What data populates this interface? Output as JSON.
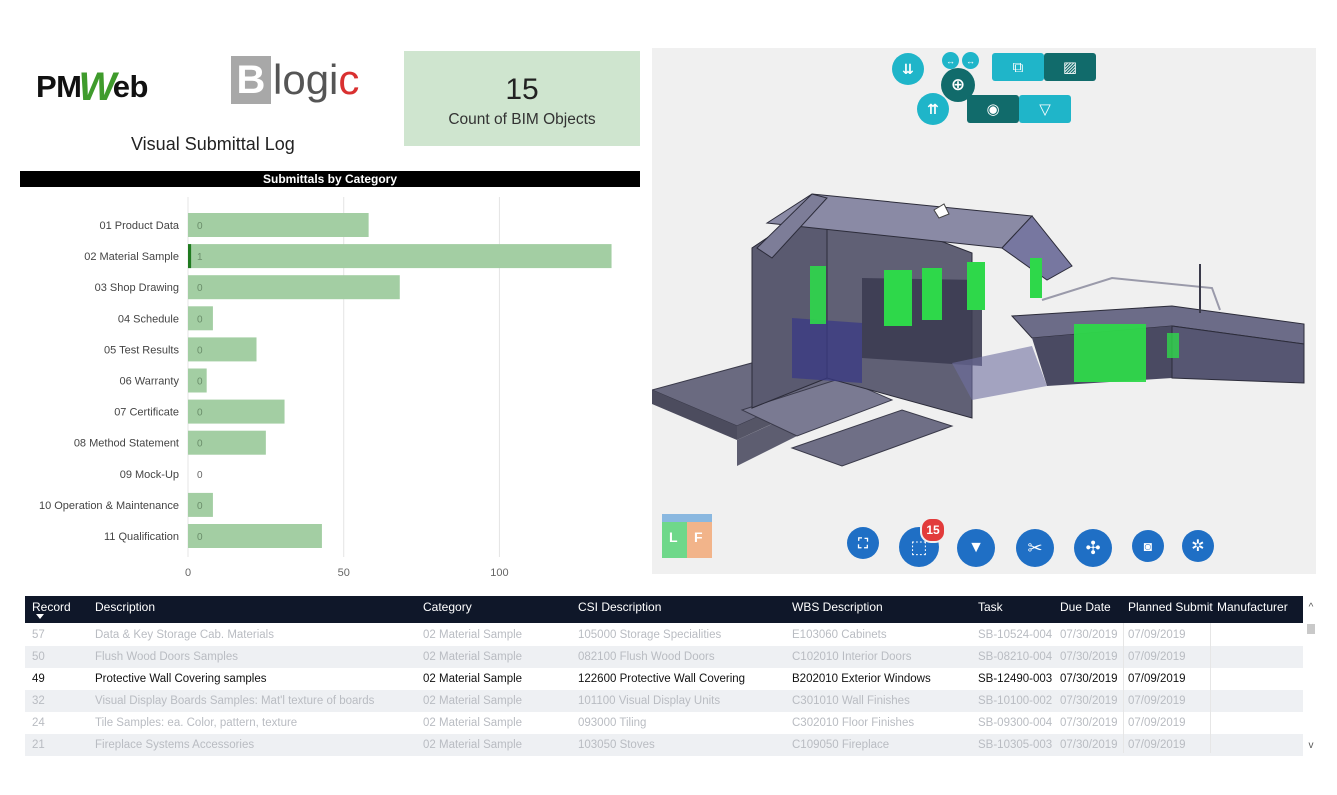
{
  "header": {
    "pmweb_prefix": "PM",
    "pmweb_w": "W",
    "pmweb_suffix": "eb",
    "blogic_b": "B",
    "blogic_mid": "logi",
    "blogic_c": "c",
    "subtitle": "Visual Submittal Log"
  },
  "kpi": {
    "value": "15",
    "label": "Count of BIM Objects"
  },
  "chart_title": "Submittals by Category",
  "chart_data": {
    "type": "bar",
    "orientation": "horizontal",
    "categories": [
      "01 Product Data",
      "02 Material Sample",
      "03 Shop Drawing",
      "04 Schedule",
      "05 Test Results",
      "06 Warranty",
      "07 Certificate",
      "08 Method Statement",
      "09 Mock-Up",
      "10 Operation & Maintenance",
      "11 Qualification"
    ],
    "series": [
      {
        "values": [
          58,
          136,
          68,
          8,
          22,
          6,
          31,
          25,
          0,
          8,
          43
        ]
      },
      {
        "values": [
          0,
          1,
          0,
          0,
          0,
          0,
          0,
          0,
          0,
          0,
          0
        ]
      }
    ],
    "data_labels": [
      "0",
      "1",
      "0",
      "0",
      "0",
      "0",
      "0",
      "0",
      "0",
      "0",
      "0"
    ],
    "xticks": [
      "0",
      "50",
      "100"
    ],
    "xlim": [
      0,
      140
    ],
    "grid": true,
    "colors": {
      "bar": "#a3ceA3",
      "highlight": "#1f7a1f"
    }
  },
  "viewer": {
    "colors": {
      "teal": "#1fb5c9",
      "dark_teal": "#116b6b",
      "blue": "#1f6fc5",
      "highlight": "#2ed84a"
    },
    "top_tools": [
      "scroll-down-icon",
      "arrows-horizontal-icon",
      "target-icon",
      "scroll-up-icon",
      "copy-icon",
      "hatch-icon",
      "record-icon",
      "filter-icon"
    ],
    "bottom_tools": [
      "fit-view-icon",
      "selection-icon",
      "clear-filter-icon",
      "cut-icon",
      "orbit-icon",
      "camera-icon",
      "settings-icon"
    ],
    "selection_badge": "15",
    "cube": {
      "left": "L",
      "right": "F"
    }
  },
  "table": {
    "columns": [
      "Record",
      "Description",
      "Category",
      "CSI Description",
      "WBS Description",
      "Task",
      "Due Date",
      "Planned Submit",
      "Manufacturer"
    ],
    "rows": [
      {
        "state": "dim",
        "cells": [
          "57",
          "Data & Key Storage Cab. Materials",
          "02 Material Sample",
          "105000 Storage Specialities",
          "E103060 Cabinets",
          "SB-10524-004",
          "07/30/2019",
          "07/09/2019",
          ""
        ]
      },
      {
        "state": "dim",
        "cells": [
          "50",
          "Flush Wood Doors Samples",
          "02 Material Sample",
          "082100 Flush Wood Doors",
          "C102010 Interior Doors",
          "SB-08210-004",
          "07/30/2019",
          "07/09/2019",
          ""
        ]
      },
      {
        "state": "hl",
        "cells": [
          "49",
          "Protective Wall Covering samples",
          "02 Material Sample",
          "122600 Protective Wall Covering",
          "B202010 Exterior Windows",
          "SB-12490-003",
          "07/30/2019",
          "07/09/2019",
          ""
        ]
      },
      {
        "state": "dim",
        "cells": [
          "32",
          "Visual Display Boards Samples: Mat'l texture of boards",
          "02 Material Sample",
          "101100 Visual Display Units",
          "C301010 Wall Finishes",
          "SB-10100-002",
          "07/30/2019",
          "07/09/2019",
          ""
        ]
      },
      {
        "state": "dim",
        "cells": [
          "24",
          "Tile Samples: ea. Color, pattern, texture",
          "02 Material Sample",
          "093000 Tiling",
          "C302010 Floor Finishes",
          "SB-09300-004",
          "07/30/2019",
          "07/09/2019",
          ""
        ]
      },
      {
        "state": "dim",
        "cells": [
          "21",
          "Fireplace Systems Accessories",
          "02 Material Sample",
          "103050 Stoves",
          "C109050 Fireplace",
          "SB-10305-003",
          "07/30/2019",
          "07/09/2019",
          ""
        ]
      }
    ]
  }
}
